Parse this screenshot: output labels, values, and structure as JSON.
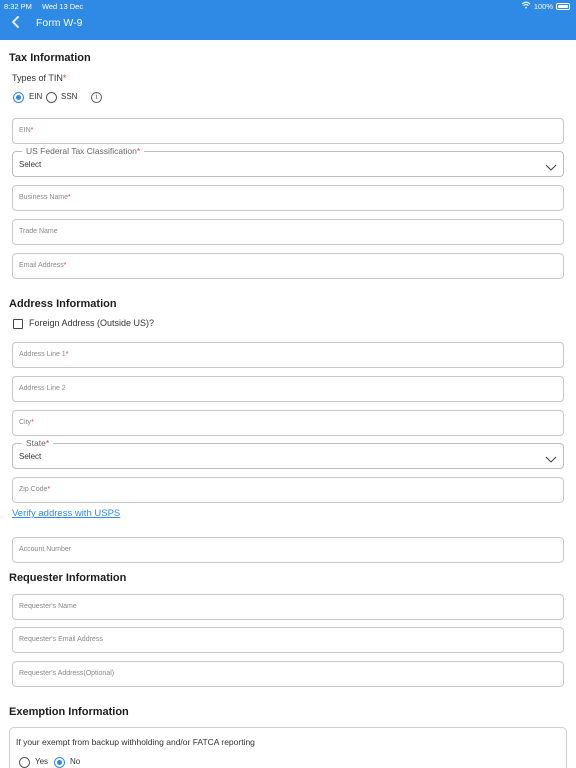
{
  "status_bar": {
    "time": "8:32 PM",
    "date": "Wed 13 Dec",
    "battery": "100%"
  },
  "nav": {
    "title": "Form W-9"
  },
  "tax": {
    "section_title": "Tax Information",
    "tin_label": "Types of TIN",
    "required_mark": "*",
    "ein_option": "EIN",
    "ssn_option": "SSN",
    "ein_field": "EIN",
    "classification_label": "US Federal Tax Classification",
    "classification_value": "Select",
    "business_name": "Business Name",
    "trade_name": "Trade Name",
    "email": "Email Address"
  },
  "address": {
    "section_title": "Address Information",
    "foreign_label": "Foreign Address (Outside US)?",
    "line1": "Address Line 1",
    "line2": "Address Line 2",
    "city": "City",
    "state_label": "State",
    "state_value": "Select",
    "zip": "Zip Code",
    "verify_link": "Verify address with USPS",
    "account_number": "Account Number"
  },
  "requester": {
    "section_title": "Requester Information",
    "name": "Requester's Name",
    "email": "Requester's Email Address",
    "address": "Requester's Address(Optional)"
  },
  "exemption": {
    "section_title": "Exemption Information",
    "question": "If your exempt from backup withholding and/or FATCA reporting",
    "yes": "Yes",
    "no": "No",
    "selected": "No"
  },
  "colors": {
    "accent": "#2f8ae6",
    "required": "#e53935"
  },
  "icons": [
    "back-chevron-icon",
    "wifi-icon",
    "battery-icon",
    "info-icon",
    "chevron-down-icon"
  ]
}
